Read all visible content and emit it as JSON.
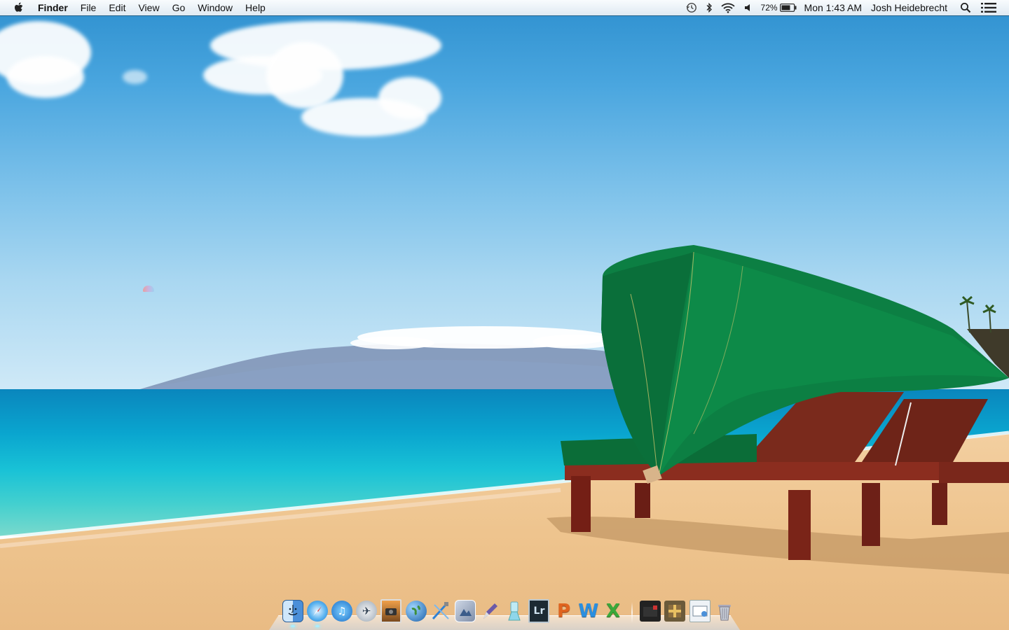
{
  "menubar": {
    "app_name": "Finder",
    "menus": [
      "File",
      "Edit",
      "View",
      "Go",
      "Window",
      "Help"
    ],
    "status": {
      "battery_percent": "72%",
      "clock": "Mon 1:43 AM",
      "user": "Josh Heidebrecht"
    }
  },
  "dock": {
    "apps": [
      {
        "icon": "finder-icon",
        "running": true
      },
      {
        "icon": "safari-icon",
        "running": true
      },
      {
        "icon": "itunes-icon",
        "running": false
      },
      {
        "icon": "mail-stamp-icon",
        "running": false
      },
      {
        "icon": "iphoto-icon",
        "running": false
      },
      {
        "icon": "globe-icon",
        "running": false
      },
      {
        "icon": "xcode-icon",
        "running": false
      },
      {
        "icon": "preview-icon",
        "running": false
      },
      {
        "icon": "pen-icon",
        "running": false
      },
      {
        "icon": "flask-icon",
        "running": false
      },
      {
        "icon": "lightroom-icon",
        "label": "Lr",
        "running": false
      },
      {
        "icon": "powerpoint-icon",
        "label": "P",
        "running": false
      },
      {
        "icon": "word-icon",
        "label": "W",
        "running": false
      },
      {
        "icon": "excel-icon",
        "label": "X",
        "running": false
      }
    ],
    "stacks": [
      {
        "icon": "folder-stack-icon"
      },
      {
        "icon": "package-stack-icon"
      },
      {
        "icon": "downloads-stack-icon"
      },
      {
        "icon": "trash-icon"
      }
    ]
  },
  "colors": {
    "canopy_green": "#0c7f43",
    "sea_turquoise": "#19c2d6",
    "sand": "#f0c995",
    "sky": "#4aa6df"
  }
}
